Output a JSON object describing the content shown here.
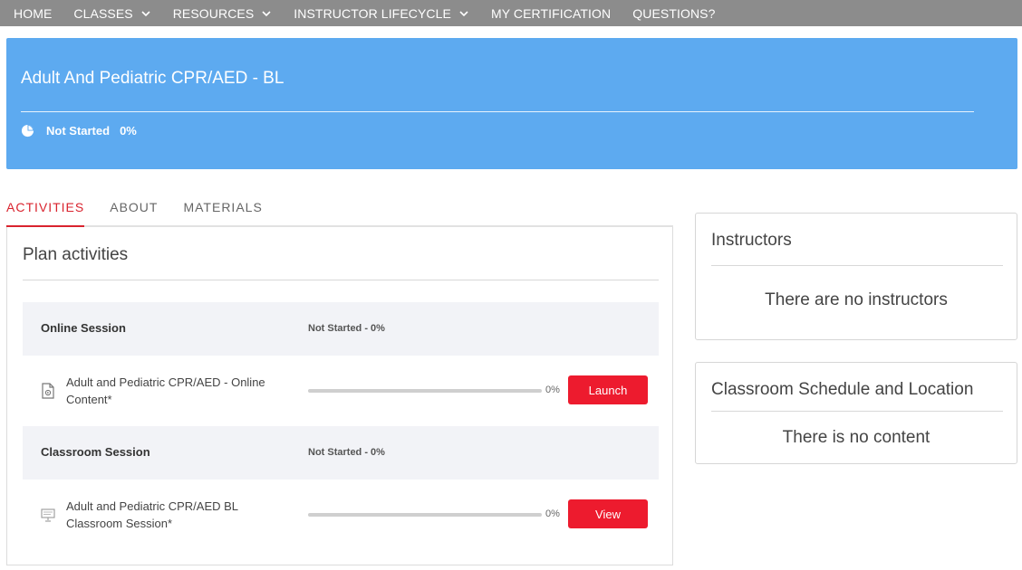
{
  "nav": {
    "items": [
      {
        "label": "HOME",
        "has_dropdown": false
      },
      {
        "label": "CLASSES",
        "has_dropdown": true
      },
      {
        "label": "RESOURCES",
        "has_dropdown": true
      },
      {
        "label": "INSTRUCTOR LIFECYCLE",
        "has_dropdown": true
      },
      {
        "label": "MY CERTIFICATION",
        "has_dropdown": false
      },
      {
        "label": "QUESTIONS?",
        "has_dropdown": false
      }
    ]
  },
  "hero": {
    "title": "Adult And Pediatric CPR/AED - BL",
    "status": "Not Started",
    "percent": "0%",
    "icon": "pie-chart-icon"
  },
  "tabs": [
    {
      "label": "ACTIVITIES",
      "active": true
    },
    {
      "label": "ABOUT",
      "active": false
    },
    {
      "label": "MATERIALS",
      "active": false
    }
  ],
  "plan": {
    "title": "Plan activities",
    "sessions": [
      {
        "name": "Online Session",
        "status": "Not Started - 0%",
        "activity": {
          "label": "Adult and Pediatric CPR/AED - Online Content*",
          "icon": "document-icon",
          "progress": 0,
          "percent": "0%",
          "button": "Launch"
        }
      },
      {
        "name": "Classroom Session",
        "status": "Not Started - 0%",
        "activity": {
          "label": "Adult and Pediatric CPR/AED BL Classroom Session*",
          "icon": "classroom-board-icon",
          "progress": 0,
          "percent": "0%",
          "button": "View"
        }
      }
    ]
  },
  "instructors": {
    "title": "Instructors",
    "empty": "There are no instructors"
  },
  "schedule": {
    "title": "Classroom Schedule and Location",
    "empty": "There is no content"
  },
  "colors": {
    "nav_bg": "#8c8c8c",
    "hero_bg": "#5daaf0",
    "accent_red": "#d9232e",
    "button_red": "#ed1b2e",
    "session_bg": "#f2f3f7"
  }
}
